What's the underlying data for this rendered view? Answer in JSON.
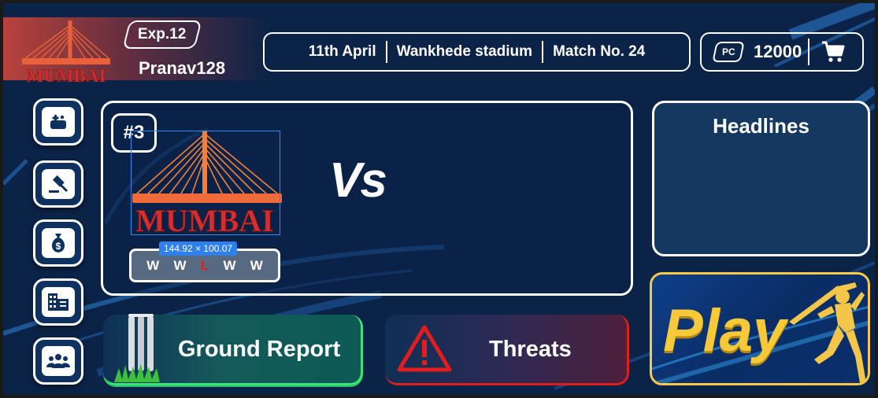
{
  "header": {
    "team_logo_text": "MUMBAI",
    "exp_label": "Exp.12",
    "username": "Pranav128",
    "match": {
      "date": "11th April",
      "venue": "Wankhede stadium",
      "match_no": "Match No. 24"
    },
    "wallet": {
      "currency_badge": "PC",
      "balance": "12000",
      "cart_icon": "cart-icon"
    }
  },
  "sidebar": {
    "items": [
      {
        "icon": "gamepad-icon"
      },
      {
        "icon": "auction-gavel-icon"
      },
      {
        "icon": "money-bag-icon"
      },
      {
        "icon": "building-icon"
      },
      {
        "icon": "team-group-icon"
      }
    ]
  },
  "match_card": {
    "rank": "#3",
    "team_name": "MUMBAI",
    "selection_size": "144.92 × 100.07",
    "recent_form": [
      "W",
      "W",
      "L",
      "W",
      "W"
    ],
    "vs_label": "Vs"
  },
  "headlines": {
    "title": "Headlines"
  },
  "actions": {
    "ground_report": "Ground Report",
    "threats": "Threats",
    "play": "Play"
  },
  "colors": {
    "background": "#0b2347",
    "win": "#ffffff",
    "loss": "#e11d1d",
    "brand_orange": "#e8613a",
    "play_gold": "#f6c93a",
    "ground_green": "#3ee27a",
    "threat_red": "#e11d1d"
  }
}
